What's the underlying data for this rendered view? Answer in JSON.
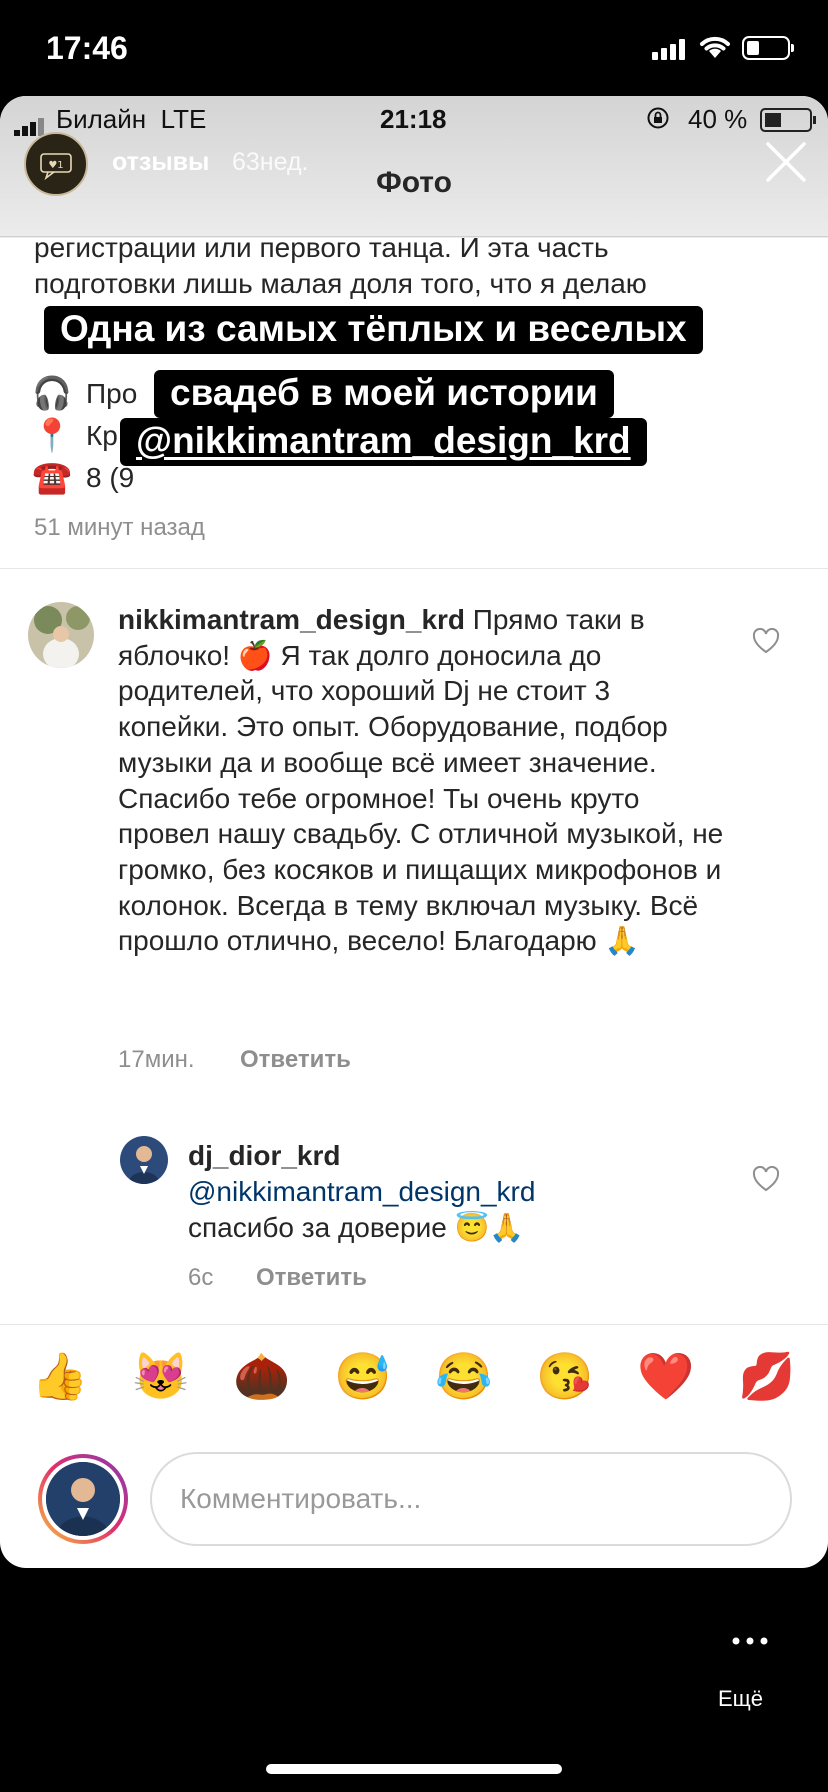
{
  "os_status": {
    "time": "17:46"
  },
  "inner_status": {
    "carrier": "Билайн",
    "network": "LTE",
    "time": "21:18",
    "battery": "40 %"
  },
  "story": {
    "account": "отзывы",
    "age": "63нед."
  },
  "header": {
    "title": "Фото"
  },
  "caption": {
    "lines": [
      "регистрации или первого танца. И эта часть",
      "подготовки лишь малая доля того, что я делаю"
    ],
    "row_headphones": "Про",
    "row_pin": "Кр",
    "row_phone": "8 (9",
    "time": "51 минут назад"
  },
  "overlay": {
    "lines": [
      "Одна из самых тёплых и веселых",
      "свадеб в моей истории",
      "@nikkimantram_design_krd"
    ]
  },
  "comments": [
    {
      "username": "nikkimantram_design_krd",
      "text_1": " Прямо таки в яблочко! ",
      "emoji_1": "🍎",
      "text_2": " Я так долго доносила до родителей, что хороший Dj не стоит 3 копейки. Это опыт. Оборудование, подбор музыки да и вообще всё имеет значение. Спасибо тебе огромное! Ты очень круто провел нашу свадьбу. С отличной музыкой, не громко, без косяков и пищащих микрофонов и колонок. Всегда в тему включал музыку. Всё прошло отлично, весело! Благодарю ",
      "emoji_2": "🙏",
      "time": "17мин.",
      "reply_label": "Ответить"
    },
    {
      "username": "dj_dior_krd",
      "mention": "@nikkimantram_design_krd",
      "text": "спасибо за доверие ",
      "emoji": "😇🙏",
      "time": "6с",
      "reply_label": "Ответить"
    }
  ],
  "emoji_bar": [
    "👍",
    "😻",
    "🌰",
    "😅",
    "😂",
    "😘",
    "❤️",
    "💋"
  ],
  "input": {
    "placeholder": "Комментировать..."
  },
  "footer": {
    "more_label": "Ещё"
  }
}
